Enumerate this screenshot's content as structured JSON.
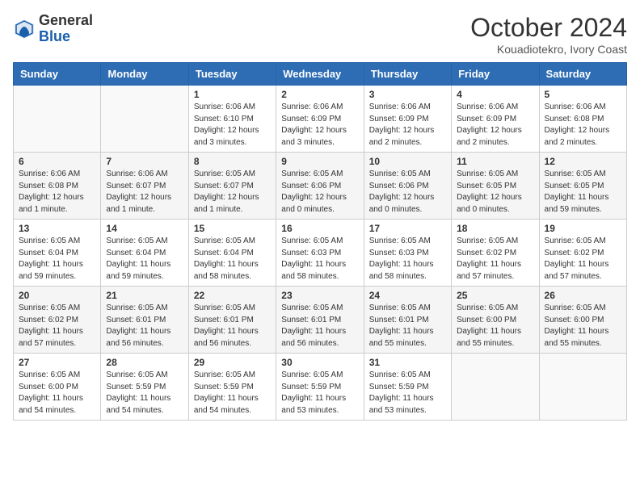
{
  "header": {
    "logo_general": "General",
    "logo_blue": "Blue",
    "month_title": "October 2024",
    "location": "Kouadiotekro, Ivory Coast"
  },
  "days_of_week": [
    "Sunday",
    "Monday",
    "Tuesday",
    "Wednesday",
    "Thursday",
    "Friday",
    "Saturday"
  ],
  "weeks": [
    [
      {
        "day": "",
        "info": ""
      },
      {
        "day": "",
        "info": ""
      },
      {
        "day": "1",
        "info": "Sunrise: 6:06 AM\nSunset: 6:10 PM\nDaylight: 12 hours\nand 3 minutes."
      },
      {
        "day": "2",
        "info": "Sunrise: 6:06 AM\nSunset: 6:09 PM\nDaylight: 12 hours\nand 3 minutes."
      },
      {
        "day": "3",
        "info": "Sunrise: 6:06 AM\nSunset: 6:09 PM\nDaylight: 12 hours\nand 2 minutes."
      },
      {
        "day": "4",
        "info": "Sunrise: 6:06 AM\nSunset: 6:09 PM\nDaylight: 12 hours\nand 2 minutes."
      },
      {
        "day": "5",
        "info": "Sunrise: 6:06 AM\nSunset: 6:08 PM\nDaylight: 12 hours\nand 2 minutes."
      }
    ],
    [
      {
        "day": "6",
        "info": "Sunrise: 6:06 AM\nSunset: 6:08 PM\nDaylight: 12 hours\nand 1 minute."
      },
      {
        "day": "7",
        "info": "Sunrise: 6:06 AM\nSunset: 6:07 PM\nDaylight: 12 hours\nand 1 minute."
      },
      {
        "day": "8",
        "info": "Sunrise: 6:05 AM\nSunset: 6:07 PM\nDaylight: 12 hours\nand 1 minute."
      },
      {
        "day": "9",
        "info": "Sunrise: 6:05 AM\nSunset: 6:06 PM\nDaylight: 12 hours\nand 0 minutes."
      },
      {
        "day": "10",
        "info": "Sunrise: 6:05 AM\nSunset: 6:06 PM\nDaylight: 12 hours\nand 0 minutes."
      },
      {
        "day": "11",
        "info": "Sunrise: 6:05 AM\nSunset: 6:05 PM\nDaylight: 12 hours\nand 0 minutes."
      },
      {
        "day": "12",
        "info": "Sunrise: 6:05 AM\nSunset: 6:05 PM\nDaylight: 11 hours\nand 59 minutes."
      }
    ],
    [
      {
        "day": "13",
        "info": "Sunrise: 6:05 AM\nSunset: 6:04 PM\nDaylight: 11 hours\nand 59 minutes."
      },
      {
        "day": "14",
        "info": "Sunrise: 6:05 AM\nSunset: 6:04 PM\nDaylight: 11 hours\nand 59 minutes."
      },
      {
        "day": "15",
        "info": "Sunrise: 6:05 AM\nSunset: 6:04 PM\nDaylight: 11 hours\nand 58 minutes."
      },
      {
        "day": "16",
        "info": "Sunrise: 6:05 AM\nSunset: 6:03 PM\nDaylight: 11 hours\nand 58 minutes."
      },
      {
        "day": "17",
        "info": "Sunrise: 6:05 AM\nSunset: 6:03 PM\nDaylight: 11 hours\nand 58 minutes."
      },
      {
        "day": "18",
        "info": "Sunrise: 6:05 AM\nSunset: 6:02 PM\nDaylight: 11 hours\nand 57 minutes."
      },
      {
        "day": "19",
        "info": "Sunrise: 6:05 AM\nSunset: 6:02 PM\nDaylight: 11 hours\nand 57 minutes."
      }
    ],
    [
      {
        "day": "20",
        "info": "Sunrise: 6:05 AM\nSunset: 6:02 PM\nDaylight: 11 hours\nand 57 minutes."
      },
      {
        "day": "21",
        "info": "Sunrise: 6:05 AM\nSunset: 6:01 PM\nDaylight: 11 hours\nand 56 minutes."
      },
      {
        "day": "22",
        "info": "Sunrise: 6:05 AM\nSunset: 6:01 PM\nDaylight: 11 hours\nand 56 minutes."
      },
      {
        "day": "23",
        "info": "Sunrise: 6:05 AM\nSunset: 6:01 PM\nDaylight: 11 hours\nand 56 minutes."
      },
      {
        "day": "24",
        "info": "Sunrise: 6:05 AM\nSunset: 6:01 PM\nDaylight: 11 hours\nand 55 minutes."
      },
      {
        "day": "25",
        "info": "Sunrise: 6:05 AM\nSunset: 6:00 PM\nDaylight: 11 hours\nand 55 minutes."
      },
      {
        "day": "26",
        "info": "Sunrise: 6:05 AM\nSunset: 6:00 PM\nDaylight: 11 hours\nand 55 minutes."
      }
    ],
    [
      {
        "day": "27",
        "info": "Sunrise: 6:05 AM\nSunset: 6:00 PM\nDaylight: 11 hours\nand 54 minutes."
      },
      {
        "day": "28",
        "info": "Sunrise: 6:05 AM\nSunset: 5:59 PM\nDaylight: 11 hours\nand 54 minutes."
      },
      {
        "day": "29",
        "info": "Sunrise: 6:05 AM\nSunset: 5:59 PM\nDaylight: 11 hours\nand 54 minutes."
      },
      {
        "day": "30",
        "info": "Sunrise: 6:05 AM\nSunset: 5:59 PM\nDaylight: 11 hours\nand 53 minutes."
      },
      {
        "day": "31",
        "info": "Sunrise: 6:05 AM\nSunset: 5:59 PM\nDaylight: 11 hours\nand 53 minutes."
      },
      {
        "day": "",
        "info": ""
      },
      {
        "day": "",
        "info": ""
      }
    ]
  ]
}
